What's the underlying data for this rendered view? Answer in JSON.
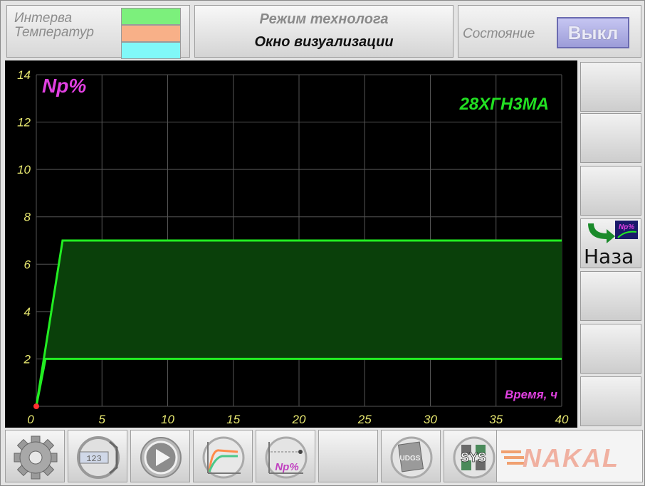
{
  "header": {
    "legend": {
      "line1": "Интерва",
      "line2": "Температур",
      "swatches": [
        "#7cf07c",
        "#f8b088",
        "#80f8f8"
      ]
    },
    "mode": {
      "title": "Режим технолога",
      "subtitle": "Окно визуализации"
    },
    "state": {
      "label": "Состояние",
      "button": "Выкл"
    }
  },
  "chart_data": {
    "type": "area",
    "y_label": "Np%",
    "x_label": "Время, ч",
    "annotation": "28ХГН3МА",
    "xlim": [
      0,
      40
    ],
    "ylim": [
      0,
      14
    ],
    "x_ticks": [
      "0",
      "5",
      "10",
      "15",
      "20",
      "25",
      "30",
      "35",
      "40"
    ],
    "y_ticks": [
      "2",
      "4",
      "6",
      "8",
      "10",
      "12",
      "14"
    ],
    "grid": true,
    "series": [
      {
        "x": [
          0,
          2,
          40
        ],
        "y": [
          0,
          7,
          7
        ]
      },
      {
        "x": [
          0,
          0.7,
          40
        ],
        "y": [
          0,
          2,
          2
        ]
      }
    ],
    "colors": {
      "line": "#22ee22",
      "fill": "#0a400a",
      "marker": "#ff3030",
      "grid": "#555555",
      "ticks": "#e8e870"
    }
  },
  "sidebar": {
    "back_button": "Наза",
    "back_icon_label": "Np%"
  },
  "toolbar": {
    "buttons": [
      "gear-icon",
      "display-123-icon",
      "play-icon",
      "curve-chart-icon",
      "np-chart-icon",
      "empty",
      "udgs-icon",
      "sys-icon"
    ],
    "display_label": "123",
    "np_label": "Np%",
    "udgs_label": "UDGS",
    "sys_label": "SYS",
    "logo": "NAKAL"
  }
}
